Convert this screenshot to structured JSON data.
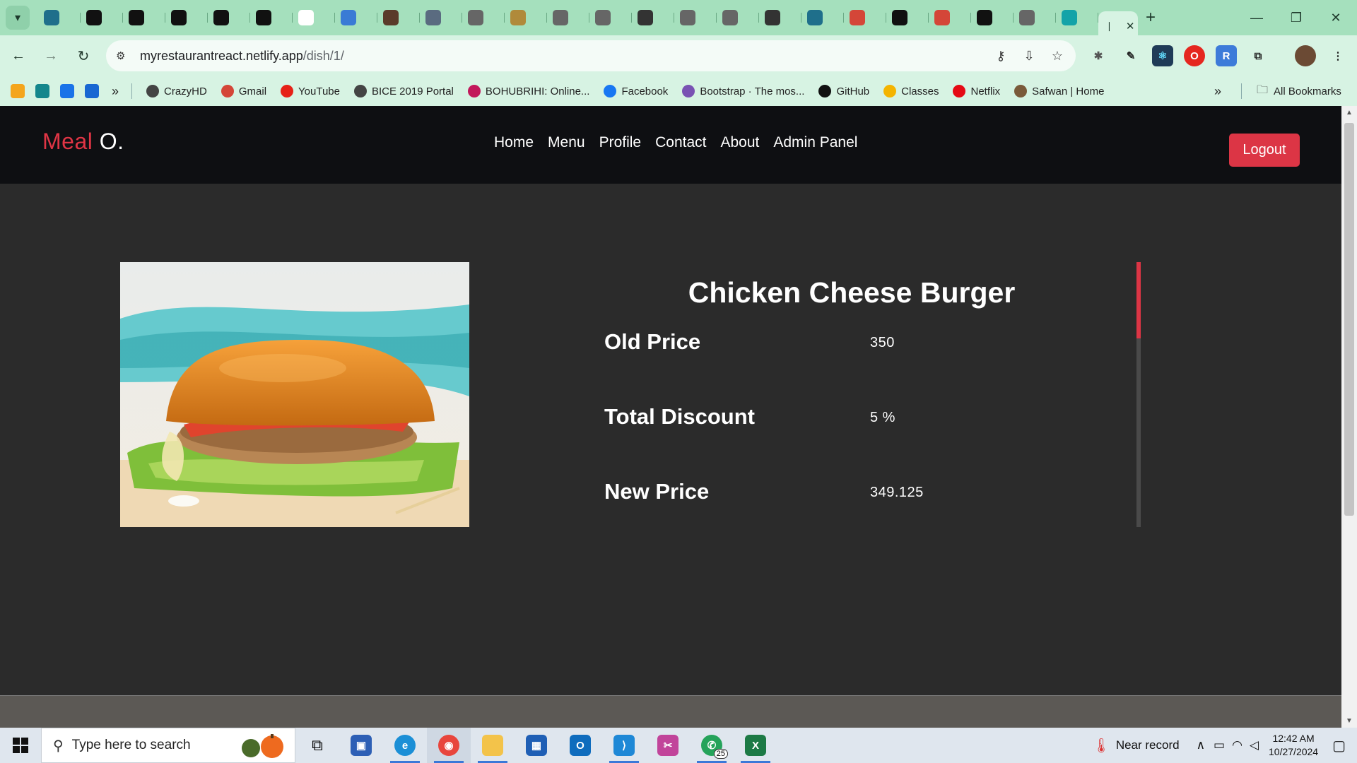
{
  "browser": {
    "tab_count_icons": [
      {
        "icon": "react-icon",
        "color": "#1f6f8b"
      },
      {
        "icon": "framer-icon",
        "color": "#111111"
      },
      {
        "icon": "square-icon",
        "color": "#111111"
      },
      {
        "icon": "square-icon",
        "color": "#111111"
      },
      {
        "icon": "square-icon",
        "color": "#111111"
      },
      {
        "icon": "square-icon",
        "color": "#111111"
      },
      {
        "icon": "openai-icon",
        "color": "#ffffff"
      },
      {
        "icon": "vite-icon",
        "color": "#3a7bd5"
      },
      {
        "icon": "avatar-icon",
        "color": "#5a3b2a"
      },
      {
        "icon": "person-icon",
        "color": "#5a6b80"
      },
      {
        "icon": "globe-icon",
        "color": "#666666"
      },
      {
        "icon": "feather-icon",
        "color": "#b08a3a"
      },
      {
        "icon": "globe-icon",
        "color": "#666666"
      },
      {
        "icon": "globe-icon",
        "color": "#666666"
      },
      {
        "icon": "swirl-icon",
        "color": "#333333"
      },
      {
        "icon": "globe-icon",
        "color": "#666666"
      },
      {
        "icon": "globe-icon",
        "color": "#666666"
      },
      {
        "icon": "swirl-icon",
        "color": "#333333"
      },
      {
        "icon": "react-icon",
        "color": "#1f6f8b"
      },
      {
        "icon": "gmail-icon",
        "color": "#d44638"
      },
      {
        "icon": "window-icon",
        "color": "#111111"
      },
      {
        "icon": "gmail-icon",
        "color": "#d44638"
      },
      {
        "icon": "github-icon",
        "color": "#111111"
      },
      {
        "icon": "globe-icon",
        "color": "#666666"
      },
      {
        "icon": "diamond-icon",
        "color": "#13a3a8"
      }
    ],
    "url_host": "myrestaurantreact.netlify.app",
    "url_path": "/dish/1/",
    "bookmarks": [
      {
        "label": "CrazyHD",
        "icon": "globe-icon",
        "color": "#444444"
      },
      {
        "label": "Gmail",
        "icon": "gmail-icon",
        "color": "#d44638"
      },
      {
        "label": "YouTube",
        "icon": "youtube-icon",
        "color": "#e62117"
      },
      {
        "label": "BICE 2019 Portal",
        "icon": "globe-icon",
        "color": "#444444"
      },
      {
        "label": "BOHUBRIHI: Online...",
        "icon": "bohubrihi-icon",
        "color": "#c2185b"
      },
      {
        "label": "Facebook",
        "icon": "facebook-icon",
        "color": "#1877f2"
      },
      {
        "label": "Bootstrap · The mos...",
        "icon": "bootstrap-icon",
        "color": "#7952b3"
      },
      {
        "label": "GitHub",
        "icon": "github-icon",
        "color": "#111111"
      },
      {
        "label": "Classes",
        "icon": "classroom-icon",
        "color": "#f4b400"
      },
      {
        "label": "Netflix",
        "icon": "netflix-icon",
        "color": "#e50914"
      },
      {
        "label": "Safwan | Home",
        "icon": "avatar-icon",
        "color": "#7a5a3a"
      }
    ],
    "all_bookmarks_label": "All Bookmarks"
  },
  "site": {
    "brand_part1": "Meal",
    "brand_part2": "O.",
    "nav": [
      "Home",
      "Menu",
      "Profile",
      "Contact",
      "About",
      "Admin Panel"
    ],
    "logout_label": "Logout",
    "brand_color": "#dc3545"
  },
  "dish": {
    "title": "Chicken Cheese Burger",
    "image_alt": "burger-photo",
    "rows": [
      {
        "label": "Old Price",
        "value": "350"
      },
      {
        "label": "Total Discount",
        "value": "5 %"
      },
      {
        "label": "New Price",
        "value": "349.125"
      }
    ]
  },
  "taskbar": {
    "search_placeholder": "Type here to search",
    "weather": "Near record",
    "time": "12:42 AM",
    "date": "10/27/2024",
    "whatsapp_badge": "25"
  }
}
